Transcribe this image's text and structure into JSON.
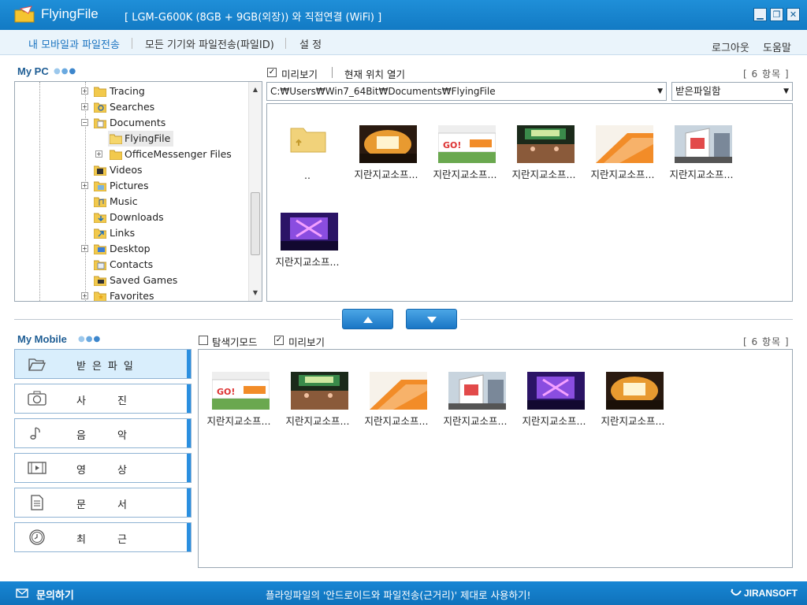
{
  "titlebar": {
    "app_name": "FlyingFile",
    "connection": "[ LGM-G600K (8GB + 9GB(외장)) 와 직접연결 (WiFi) ]"
  },
  "menu": {
    "tab_mobile": "내 모바일과 파일전송",
    "tab_all": "모든 기기와 파일전송(파일ID)",
    "tab_settings": "설 정",
    "logout": "로그아웃",
    "help": "도움말"
  },
  "mypc": {
    "title": "My PC",
    "tree": [
      {
        "label": "Tracing"
      },
      {
        "label": "Searches"
      },
      {
        "label": "Documents"
      },
      {
        "label": "FlyingFile"
      },
      {
        "label": "OfficeMessenger Files"
      },
      {
        "label": "Videos"
      },
      {
        "label": "Pictures"
      },
      {
        "label": "Music"
      },
      {
        "label": "Downloads"
      },
      {
        "label": "Links"
      },
      {
        "label": "Desktop"
      },
      {
        "label": "Contacts"
      },
      {
        "label": "Saved Games"
      },
      {
        "label": "Favorites"
      }
    ],
    "preview_label": "미리보기",
    "open_location": "현재 위치 열기",
    "count": "[ 6 항목 ]",
    "path": "C:₩Users₩Win7_64Bit₩Documents₩FlyingFile",
    "folder_select": "받은파일함",
    "files": [
      {
        "label": ".."
      },
      {
        "label": "지란지교소프..."
      },
      {
        "label": "지란지교소프..."
      },
      {
        "label": "지란지교소프..."
      },
      {
        "label": "지란지교소프..."
      },
      {
        "label": "지란지교소프..."
      },
      {
        "label": "지란지교소프..."
      }
    ]
  },
  "mymobile": {
    "title": "My Mobile",
    "explorer_mode": "탐색기모드",
    "preview_label": "미리보기",
    "count": "[ 6 항목 ]",
    "categories": [
      {
        "label": "받은파일"
      },
      {
        "label": "사진"
      },
      {
        "label": "음악"
      },
      {
        "label": "영상"
      },
      {
        "label": "문서"
      },
      {
        "label": "최근"
      }
    ],
    "files": [
      {
        "label": "지란지교소프..."
      },
      {
        "label": "지란지교소프..."
      },
      {
        "label": "지란지교소프..."
      },
      {
        "label": "지란지교소프..."
      },
      {
        "label": "지란지교소프..."
      },
      {
        "label": "지란지교소프..."
      }
    ]
  },
  "status": {
    "inquiry": "문의하기",
    "message": "플라잉파일의 '안드로이드와 파일전송(근거리)' 제대로 사용하기!",
    "brand": "JIRANSOFT"
  },
  "colors": {
    "accent": "#1a7fcc",
    "panel_border": "#9aa7b3"
  }
}
